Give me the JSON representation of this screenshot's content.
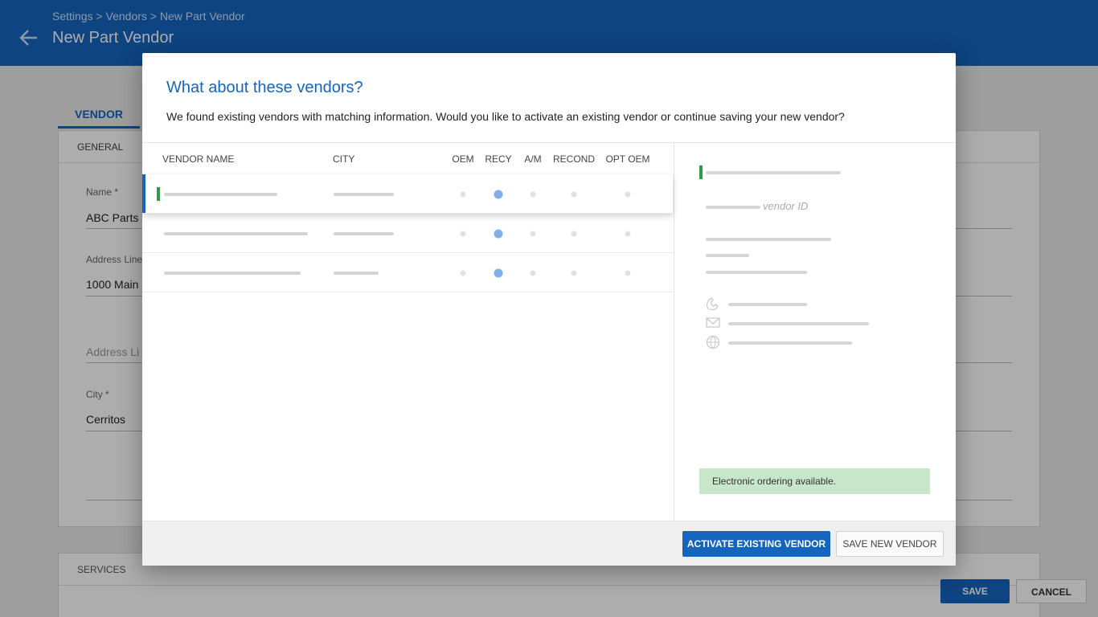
{
  "header": {
    "breadcrumb": "Settings > Vendors > New Part Vendor",
    "title": "New Part Vendor"
  },
  "tabs": {
    "vendor": "VENDOR"
  },
  "general_card": {
    "heading": "GENERAL",
    "name_label": "Name *",
    "name_value": "ABC Parts",
    "address1_label": "Address Line",
    "address1_value": "1000 Main",
    "address2_placeholder": "Address Li",
    "city_label": "City *",
    "city_value": "Cerritos"
  },
  "services_card": {
    "heading": "SERVICES"
  },
  "page_actions": {
    "save": "SAVE",
    "cancel": "CANCEL"
  },
  "modal": {
    "title": "What about these vendors?",
    "subtitle": "We found existing vendors with matching information. Would you like to activate an existing vendor or continue saving your new vendor?",
    "columns": {
      "vendor_name": "VENDOR NAME",
      "city": "CITY",
      "oem": "OEM",
      "recy": "RECY",
      "am": "A/M",
      "recond": "RECOND",
      "opt_oem": "OPT OEM"
    },
    "rows": [
      {
        "selected": true,
        "status": "green",
        "oem": false,
        "recy": true,
        "am": false,
        "recond": false,
        "opt_oem": false
      },
      {
        "selected": false,
        "status": "none",
        "oem": false,
        "recy": true,
        "am": false,
        "recond": false,
        "opt_oem": false
      },
      {
        "selected": false,
        "status": "none",
        "oem": false,
        "recy": true,
        "am": false,
        "recond": false,
        "opt_oem": false
      }
    ],
    "detail": {
      "vendor_id_label": "vendor ID",
      "icons": [
        "phone-icon",
        "email-icon",
        "web-icon"
      ],
      "electronic_ordering": "Electronic ordering available."
    },
    "buttons": {
      "activate": "ACTIVATE EXISTING VENDOR",
      "save_new": "SAVE NEW VENDOR"
    }
  },
  "colors": {
    "primary": "#1565c0",
    "status_green": "#2e9b45",
    "active_dot": "#7fb0ea",
    "success_bg": "#c8e6c9"
  }
}
